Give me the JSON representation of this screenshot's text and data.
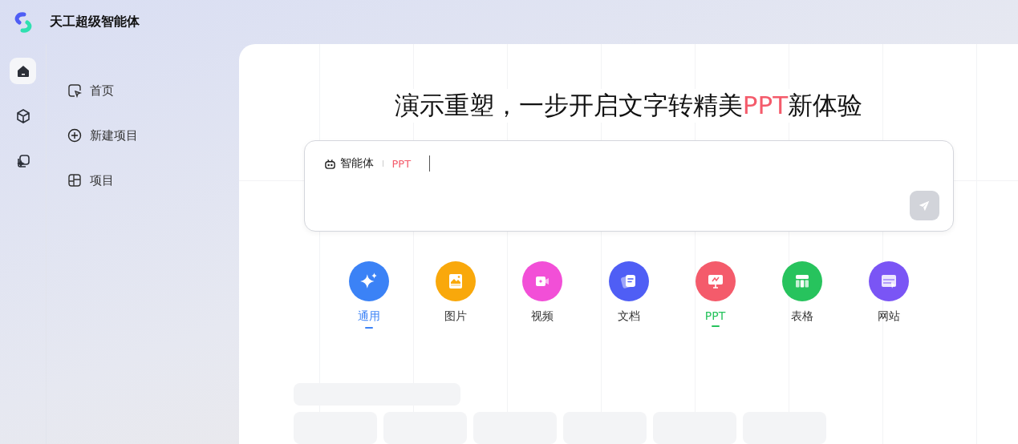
{
  "app": {
    "name": "天工超级智能体"
  },
  "rail": [
    {
      "selected": true
    },
    {
      "selected": false
    },
    {
      "selected": false
    }
  ],
  "nav": [
    {
      "label": "首页"
    },
    {
      "label": "新建项目"
    },
    {
      "label": "项目"
    }
  ],
  "headline": {
    "prefix": "演示重塑，一步开启文字转精美",
    "highlight": "PPT",
    "suffix": "新体验"
  },
  "composer": {
    "agent_label": "智能体",
    "agent_tag": "PPT"
  },
  "categories": [
    {
      "label": "通用",
      "color": "#3b82f6",
      "focused": true,
      "selected": false
    },
    {
      "label": "图片",
      "color": "#f9a80b",
      "focused": false,
      "selected": false
    },
    {
      "label": "视频",
      "color": "#f24fd7",
      "focused": false,
      "selected": false
    },
    {
      "label": "文档",
      "color": "#4f5ef5",
      "focused": false,
      "selected": false
    },
    {
      "label": "PPT",
      "color": "#f45b6b",
      "focused": false,
      "selected": true
    },
    {
      "label": "表格",
      "color": "#27c35d",
      "focused": false,
      "selected": false
    },
    {
      "label": "网站",
      "color": "#7a55f5",
      "focused": false,
      "selected": false
    }
  ]
}
